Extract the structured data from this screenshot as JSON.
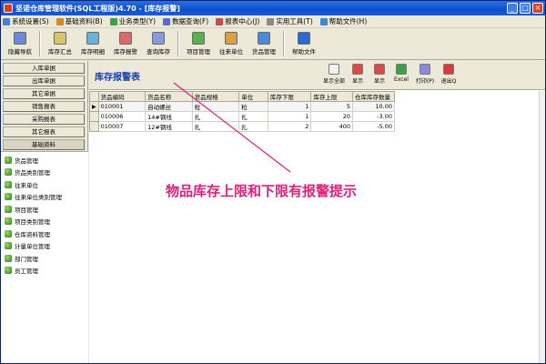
{
  "window": {
    "title": "坚诺仓库管理软件(SQL工程版)4.70 - [库存报警]",
    "controls": [
      "_",
      "□",
      "×"
    ]
  },
  "menu": [
    {
      "label": "系统设置(S)",
      "color": "#4a7fd0"
    },
    {
      "label": "基础资料(B)",
      "color": "#d08a2a"
    },
    {
      "label": "业务类型(Y)",
      "color": "#3aa04a"
    },
    {
      "label": "数据查询(F)",
      "color": "#5a6ad0"
    },
    {
      "label": "报表中心(J)",
      "color": "#c84a4a"
    },
    {
      "label": "实用工具(T)",
      "color": "#8a8a8a"
    },
    {
      "label": "帮助文件(H)",
      "color": "#3a8ad0"
    }
  ],
  "toolbar": [
    {
      "label": "隐藏导航",
      "color": "#6a8ad8"
    },
    {
      "label": "库存汇总",
      "color": "#d8c46a"
    },
    {
      "label": "库存明细",
      "color": "#6ab0d8"
    },
    {
      "label": "库存报警",
      "color": "#d86a6a"
    },
    {
      "label": "查询库存",
      "color": "#8a9ad8"
    },
    {
      "label": "项目管理",
      "color": "#5ab04a"
    },
    {
      "label": "往来单位",
      "color": "#d8a04a"
    },
    {
      "label": "货品管理",
      "color": "#4a8ad8"
    },
    {
      "label": "帮助文件",
      "color": "#2a6ad0"
    }
  ],
  "nav_buttons": [
    {
      "label": "入库单据"
    },
    {
      "label": "出库单据"
    },
    {
      "label": "其它单据"
    },
    {
      "label": "销售报表"
    },
    {
      "label": "采购报表"
    },
    {
      "label": "其它报表"
    },
    {
      "label": "基础资料"
    }
  ],
  "nav_items": [
    "货品管理",
    "货品类别管理",
    "往来单位",
    "往来单位类别管理",
    "项目管理",
    "项目类别管理",
    "仓库资料管理",
    "计量单位管理",
    "部门管理",
    "员工管理"
  ],
  "main": {
    "title": "库存报警表",
    "actions": [
      {
        "label": "显示全部",
        "color": "#e8e8e8"
      },
      {
        "label": "显示",
        "color": "#d84a4a"
      },
      {
        "label": "显示",
        "color": "#d84a4a"
      },
      {
        "label": "Excel",
        "color": "#3aa04a"
      },
      {
        "label": "打印(P)",
        "color": "#8a8ad8"
      },
      {
        "label": "退出Q",
        "color": "#d83a3a"
      }
    ],
    "columns": [
      "货品编码",
      "货品名称",
      "货品规格",
      "单位",
      "库存下限",
      "库存上限",
      "仓库库存数量"
    ],
    "rows": [
      {
        "indicator": "▶",
        "cells": [
          "010001",
          "自动螺丝",
          "粒",
          "粒",
          "1",
          "5",
          "10.00"
        ]
      },
      {
        "indicator": "",
        "cells": [
          "010006",
          "14#钢线",
          "扎",
          "扎",
          "1",
          "20",
          "-3.00"
        ]
      },
      {
        "indicator": "",
        "cells": [
          "010007",
          "12#钢线",
          "扎",
          "扎",
          "2",
          "400",
          "-5.00"
        ]
      }
    ]
  },
  "annotation": {
    "text": "物品库存上限和下限有报警提示",
    "color": "#e0207a"
  }
}
